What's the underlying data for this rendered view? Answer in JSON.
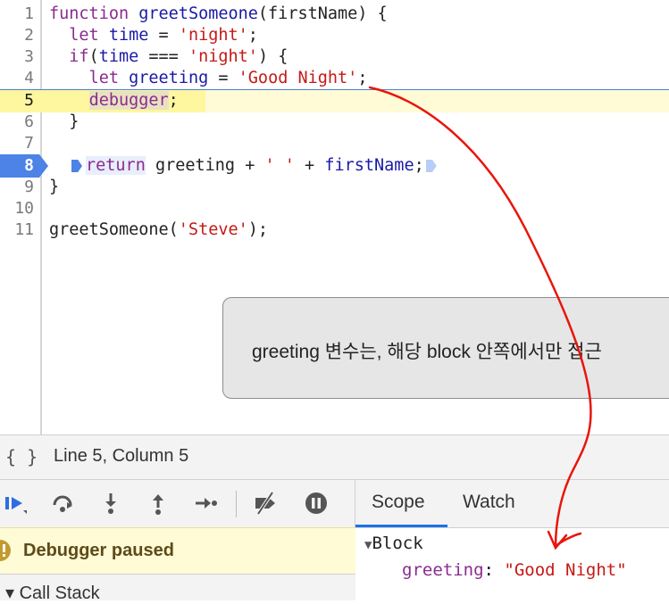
{
  "editor": {
    "line_numbers": [
      "1",
      "2",
      "3",
      "4",
      "5",
      "6",
      "7",
      "8",
      "9",
      "10",
      "11"
    ],
    "lines": {
      "l1": {
        "kw": "function",
        "fn": "greetSomeone",
        "rest": "(firstName) {"
      },
      "l2": {
        "kw": "let",
        "name": "time",
        "op": " = ",
        "str": "'night'",
        "end": ";"
      },
      "l3": {
        "kw": "if",
        "open": "(",
        "name": "time",
        "op": " === ",
        "str": "'night'",
        "end": ") {"
      },
      "l4": {
        "kw": "let",
        "name": "greeting",
        "op": " = ",
        "str": "'Good Night'",
        "end": ";"
      },
      "l5": {
        "kw": "debugger",
        "end": ";"
      },
      "l6": {
        "text": "}"
      },
      "l8": {
        "kw": "return",
        "name": "greeting",
        "op1": " + ",
        "str": "' '",
        "op2": " + ",
        "name2": "firstName",
        "end": ";"
      },
      "l9": {
        "text": "}"
      },
      "l11": {
        "fn": "greetSomeone",
        "open": "(",
        "str": "'Steve'",
        "end": ");"
      }
    },
    "active_line": "5",
    "breakpoint_line": "8"
  },
  "tooltip": {
    "text": "greeting 변수는, 해당 block 안쪽에서만 접근"
  },
  "status": {
    "braces_icon": "{ }",
    "position": "Line 5, Column 5"
  },
  "debug_toolbar": {
    "icons": [
      "resume-icon",
      "step-over-icon",
      "step-into-icon",
      "step-out-icon",
      "step-icon",
      "deactivate-breakpoints-icon",
      "pause-on-exceptions-icon"
    ]
  },
  "paused_banner": {
    "text": "Debugger paused"
  },
  "call_stack": {
    "label": "Call Stack"
  },
  "tabs": {
    "scope": "Scope",
    "watch": "Watch"
  },
  "scope": {
    "block_label": "Block",
    "var_name": "greeting",
    "var_sep": ": ",
    "var_value": "\"Good Night\""
  },
  "colors": {
    "keyword": "#8a2c8f",
    "string": "#c41a16",
    "identifier": "#1a1aa6",
    "breakpoint": "#4d82e6",
    "highlight": "#fffbd6",
    "annotation": "#e8150c"
  }
}
